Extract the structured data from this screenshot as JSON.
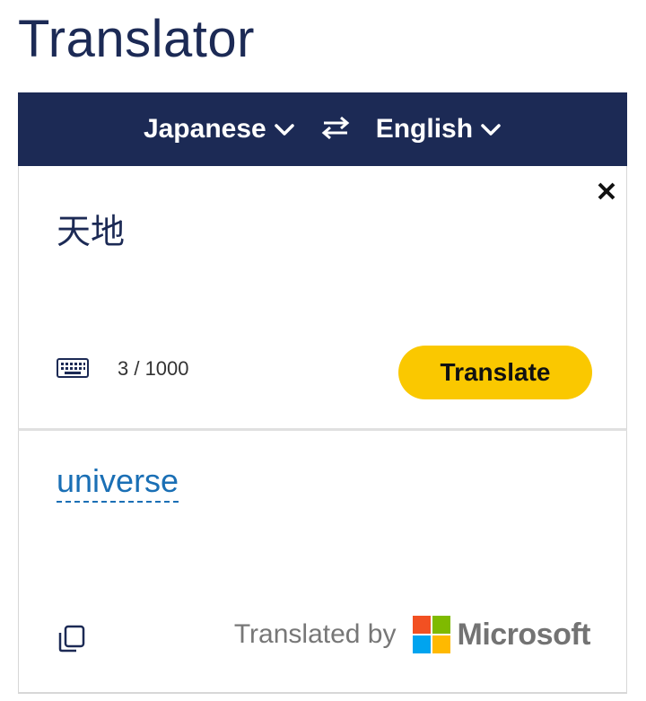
{
  "app": {
    "title": "Translator"
  },
  "language_bar": {
    "source_language": "Japanese",
    "target_language": "English",
    "source_icon": "chevron-down-icon",
    "swap_icon": "swap-arrows-icon",
    "target_icon": "chevron-down-icon"
  },
  "input": {
    "text": "天地",
    "char_count": "3 / 1000",
    "translate_label": "Translate",
    "clear_icon": "close-icon",
    "keyboard_icon": "keyboard-icon"
  },
  "output": {
    "text": "universe",
    "copy_icon": "copy-icon",
    "credit_label": "Translated by",
    "brand": "Microsoft"
  },
  "colors": {
    "header_bg": "#1c2a55",
    "title": "#1c2a55",
    "button_bg": "#fac800",
    "result_link": "#1a6fb5",
    "ms_red": "#f25022",
    "ms_green": "#7fba00",
    "ms_blue": "#00a4ef",
    "ms_yellow": "#ffb900"
  }
}
